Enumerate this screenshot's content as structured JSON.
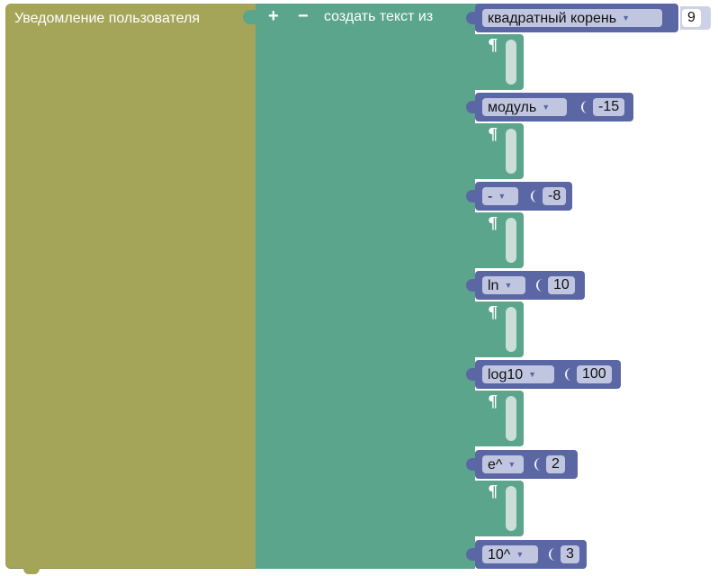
{
  "alert": {
    "label": "Уведомление пользователя"
  },
  "join": {
    "label": "создать текст из",
    "add_label": "+",
    "remove_label": "−"
  },
  "text_blocks": [
    {
      "icon": "¶",
      "value": ""
    },
    {
      "icon": "¶",
      "value": ""
    },
    {
      "icon": "¶",
      "value": ""
    },
    {
      "icon": "¶",
      "value": ""
    },
    {
      "icon": "¶",
      "value": ""
    },
    {
      "icon": "¶",
      "value": ""
    }
  ],
  "math_blocks": [
    {
      "operator": "квадратный корень",
      "value": "9"
    },
    {
      "operator": "модуль",
      "value": "-15"
    },
    {
      "operator": "-",
      "value": "-8"
    },
    {
      "operator": "ln",
      "value": "10"
    },
    {
      "operator": "log10",
      "value": "100"
    },
    {
      "operator": "e^",
      "value": "2"
    },
    {
      "operator": "10^",
      "value": "3"
    }
  ],
  "colors": {
    "alert_block": "#a5a55a",
    "text_block": "#5ba58c",
    "math_block": "#5b67a5",
    "dropdown_bg": "#c1c6e0"
  },
  "icons": {
    "dropdown": "▼",
    "text": "pilcrow-icon"
  }
}
